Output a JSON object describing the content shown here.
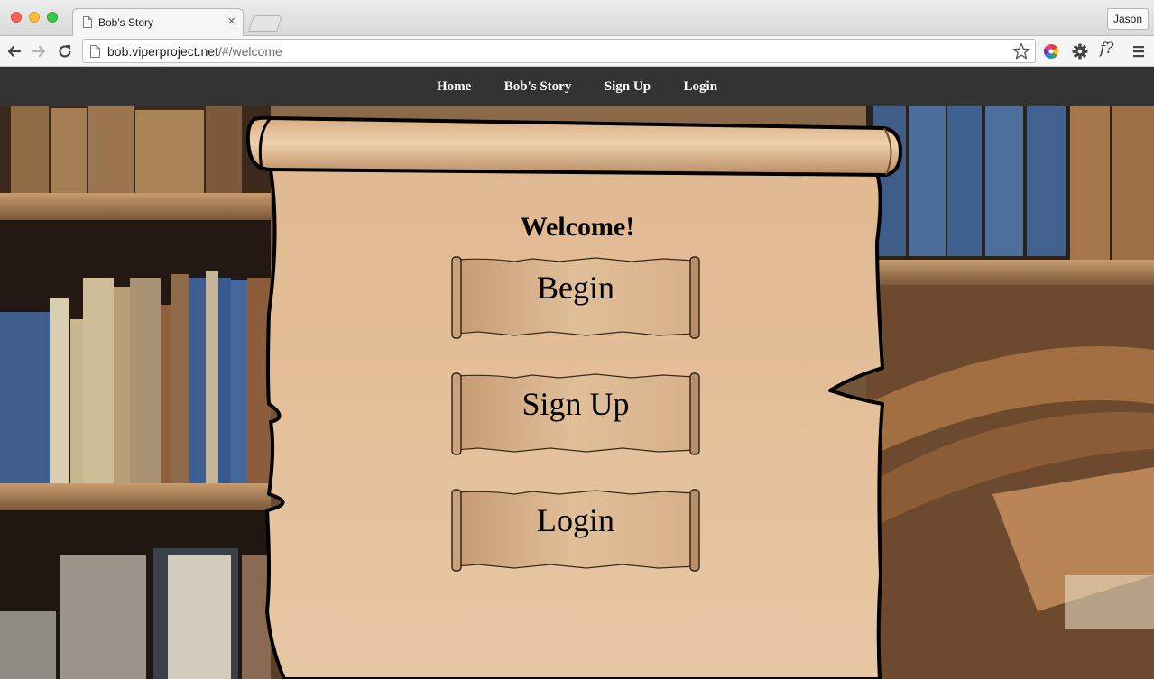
{
  "browser": {
    "tab_title": "Bob's Story",
    "tab_close": "×",
    "profile_name": "Jason",
    "url_host": "bob.viperproject.net",
    "url_rest": "/#/welcome",
    "ext_font_icon_text": "f?"
  },
  "site": {
    "nav": [
      "Home",
      "Bob's Story",
      "Sign Up",
      "Login"
    ],
    "welcome": "Welcome!",
    "buttons": [
      "Begin",
      "Sign Up",
      "Login"
    ]
  },
  "colors": {
    "nav_bg": "#333333",
    "parchment": "#e3bf97",
    "parchment_dark": "#cda37c"
  }
}
